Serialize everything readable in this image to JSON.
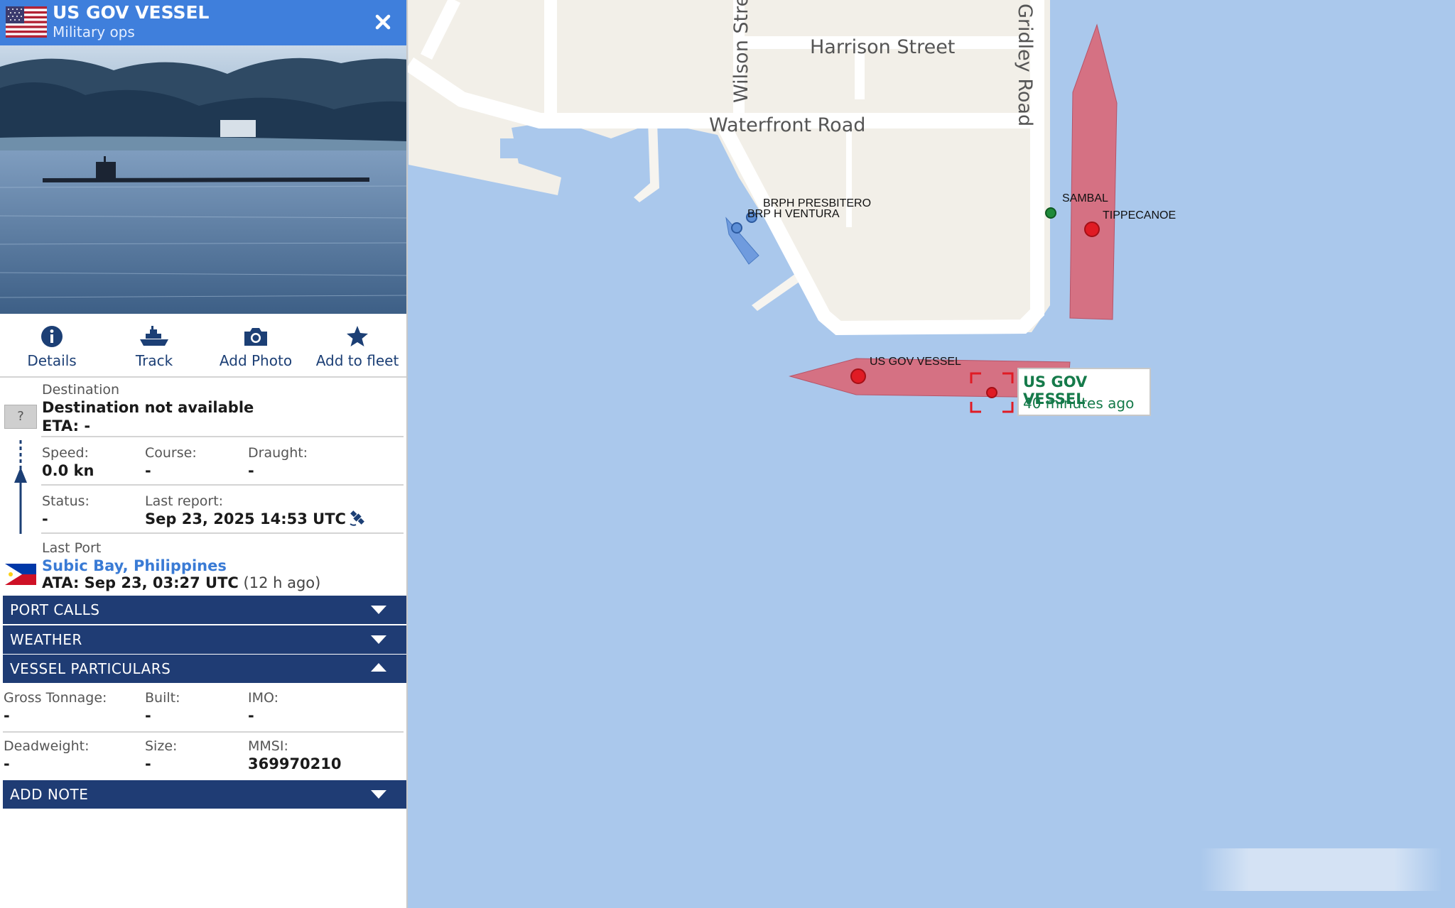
{
  "header": {
    "vessel_name": "US GOV VESSEL",
    "vessel_type": "Military ops",
    "flag_icon": "us-flag-icon",
    "close_icon": "close-icon"
  },
  "actions": [
    {
      "label": "Details",
      "icon": "info-icon"
    },
    {
      "label": "Track",
      "icon": "ship-icon"
    },
    {
      "label": "Add Photo",
      "icon": "camera-icon"
    },
    {
      "label": "Add to fleet",
      "icon": "star-icon"
    }
  ],
  "voyage": {
    "destination_label": "Destination",
    "destination_value": "Destination not available",
    "eta": "ETA: -",
    "unknown_icon_text": "?",
    "speed_label": "Speed:",
    "speed_value": "0.0 kn",
    "course_label": "Course:",
    "course_value": "-",
    "draught_label": "Draught:",
    "draught_value": "-",
    "status_label": "Status:",
    "status_value": "-",
    "last_report_label": "Last report:",
    "last_report_value": "Sep 23, 2025 14:53 UTC",
    "last_port_label": "Last Port",
    "last_port_value": "Subic Bay, Philippines",
    "ata_value": "ATA: Sep 23, 03:27 UTC",
    "ata_ago": "(12 h ago)"
  },
  "sections": {
    "port_calls": "PORT CALLS",
    "weather": "WEATHER",
    "vessel_particulars": "VESSEL PARTICULARS",
    "add_note": "ADD NOTE"
  },
  "particulars": {
    "gross_tonnage_label": "Gross Tonnage:",
    "gross_tonnage_value": "-",
    "built_label": "Built:",
    "built_value": "-",
    "imo_label": "IMO:",
    "imo_value": "-",
    "deadweight_label": "Deadweight:",
    "deadweight_value": "-",
    "size_label": "Size:",
    "size_value": "-",
    "mmsi_label": "MMSI:",
    "mmsi_value": "369970210"
  },
  "map": {
    "streets": {
      "harrison": "Harrison Street",
      "waterfront": "Waterfront Road",
      "wilson": "Wilson Stre",
      "gridley": "Gridley Road"
    },
    "vessel_labels": {
      "presbitero": "BRPH PRESBITERO",
      "ventura": "BRP H VENTURA",
      "sambal": "SAMBAL",
      "tippecanoe": "TIPPECANOE",
      "us_gov": "US GOV VESSEL"
    },
    "tooltip": {
      "name": "US GOV VESSEL",
      "time": "40 minutes ago"
    },
    "colors": {
      "water": "#aac8ec",
      "land": "#f2efe8",
      "road": "#ffffff",
      "military_vessel": "#d96a7b",
      "blue_vessel": "#5d8fd6",
      "green_dot": "#1f8a3a",
      "red_dot": "#e01b24"
    }
  }
}
